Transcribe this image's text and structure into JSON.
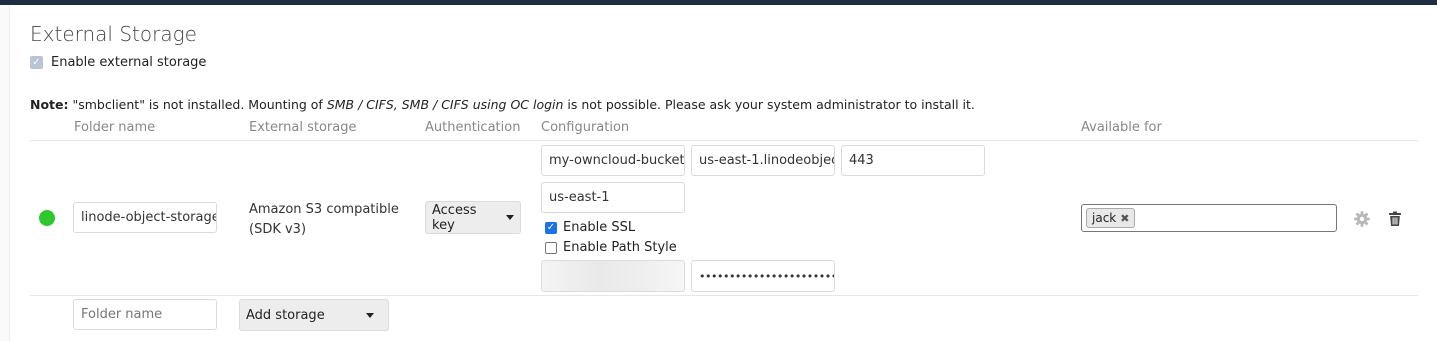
{
  "section": {
    "title": "External Storage",
    "enable_label": "Enable external storage"
  },
  "note": {
    "prefix": "Note:",
    "text1": " \"smbclient\" is not installed. Mounting of ",
    "emph": "SMB / CIFS, SMB / CIFS using OC login",
    "text2": " is not possible. Please ask your system administrator to install it."
  },
  "headers": {
    "folder_name": "Folder name",
    "external_storage": "External storage",
    "authentication": "Authentication",
    "configuration": "Configuration",
    "available_for": "Available for"
  },
  "mount": {
    "status_color": "#2ec72e",
    "folder_name": "linode-object-storage",
    "storage_line1": "Amazon S3 compatible",
    "storage_line2": "(SDK v3)",
    "auth": "Access key",
    "bucket": "my-owncloud-bucket",
    "hostname": "us-east-1.linodeobjec",
    "port": "443",
    "region": "us-east-1",
    "enable_ssl_label": "Enable SSL",
    "enable_ssl": true,
    "path_style_label": "Enable Path Style",
    "path_style": false,
    "secret_masked": "••••••••••••••••••••••••••••",
    "available_for": [
      "jack"
    ]
  },
  "new_mount": {
    "folder_placeholder": "Folder name",
    "add_storage": "Add storage"
  },
  "icons": {
    "settings": "gear-icon",
    "delete": "trash-icon"
  }
}
